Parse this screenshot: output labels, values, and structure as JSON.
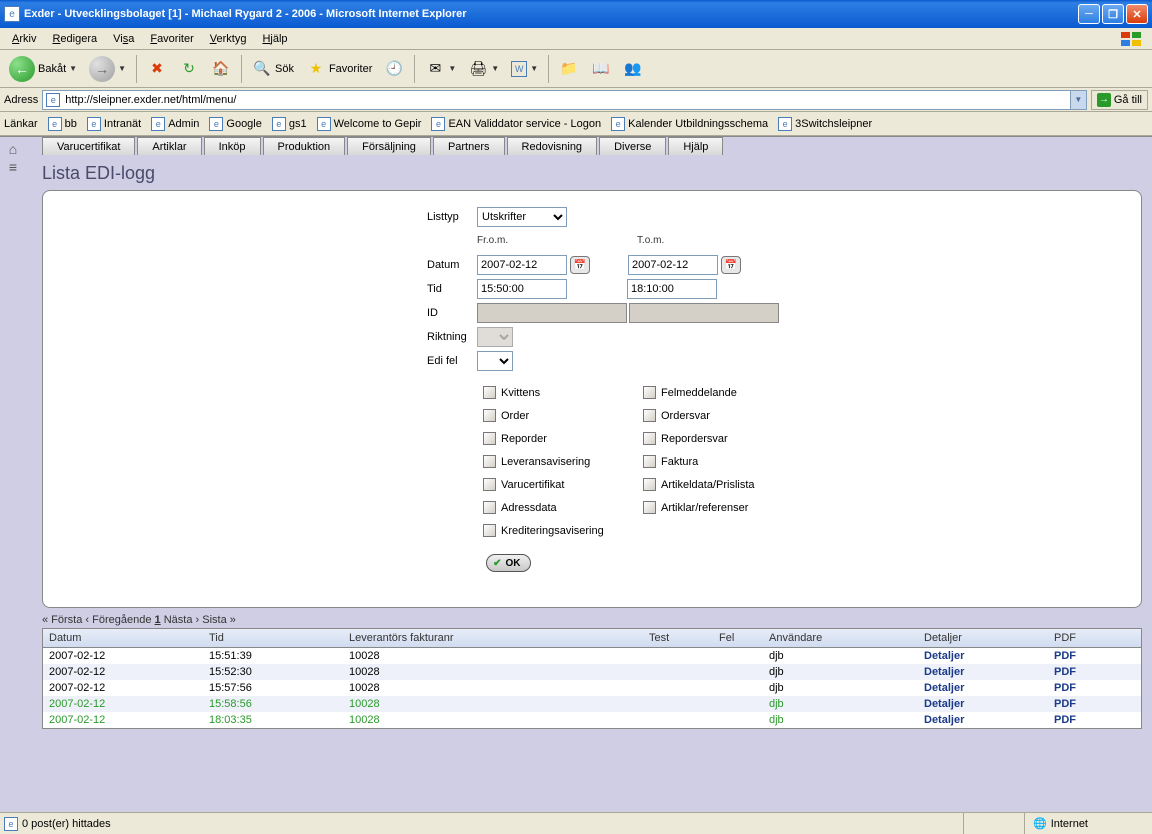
{
  "window": {
    "title": "Exder - Utvecklingsbolaget [1] - Michael Rygard 2 - 2006 - Microsoft Internet Explorer"
  },
  "menu": {
    "items": [
      "Arkiv",
      "Redigera",
      "Visa",
      "Favoriter",
      "Verktyg",
      "Hjälp"
    ]
  },
  "toolbar": {
    "back": "Bakåt",
    "search": "Sök",
    "favorites": "Favoriter"
  },
  "address": {
    "label": "Adress",
    "url": "http://sleipner.exder.net/html/menu/",
    "go": "Gå till"
  },
  "links": {
    "label": "Länkar",
    "items": [
      "bb",
      "Intranät",
      "Admin",
      "Google",
      "gs1",
      "Welcome to Gepir",
      "EAN Validdator service - Logon",
      "Kalender Utbildningsschema",
      "3Switchsleipner"
    ]
  },
  "app": {
    "tabs": [
      "Varucertifikat",
      "Artiklar",
      "Inköp",
      "Produktion",
      "Försäljning",
      "Partners",
      "Redovisning",
      "Diverse",
      "Hjälp"
    ],
    "title": "Lista EDI-logg"
  },
  "form": {
    "listtyp_label": "Listtyp",
    "listtyp_value": "Utskrifter",
    "from_label": "Fr.o.m.",
    "to_label": "T.o.m.",
    "datum_label": "Datum",
    "datum_from": "2007-02-12",
    "datum_to": "2007-02-12",
    "tid_label": "Tid",
    "tid_from": "15:50:00",
    "tid_to": "18:10:00",
    "id_label": "ID",
    "riktning_label": "Riktning",
    "edifel_label": "Edi fel",
    "ok": "OK"
  },
  "checks": {
    "left": [
      "Kvittens",
      "Order",
      "Reporder",
      "Leveransavisering",
      "Varucertifikat",
      "Adressdata",
      "Krediteringsavisering"
    ],
    "right": [
      "Felmeddelande",
      "Ordersvar",
      "Repordersvar",
      "Faktura",
      "Artikeldata/Prislista",
      "Artiklar/referenser"
    ]
  },
  "pager": {
    "first": "« Första",
    "prev": "‹ Föregående",
    "cur": "1",
    "next": "Nästa ›",
    "last": "Sista »"
  },
  "table": {
    "headers": [
      "Datum",
      "Tid",
      "Leverantörs fakturanr",
      "Test",
      "Fel",
      "Användare",
      "Detaljer",
      "PDF"
    ],
    "rows": [
      {
        "datum": "2007-02-12",
        "tid": "15:51:39",
        "lev": "10028",
        "test": "",
        "fel": "",
        "anv": "djb",
        "green": false
      },
      {
        "datum": "2007-02-12",
        "tid": "15:52:30",
        "lev": "10028",
        "test": "",
        "fel": "",
        "anv": "djb",
        "green": false
      },
      {
        "datum": "2007-02-12",
        "tid": "15:57:56",
        "lev": "10028",
        "test": "",
        "fel": "",
        "anv": "djb",
        "green": false
      },
      {
        "datum": "2007-02-12",
        "tid": "15:58:56",
        "lev": "10028",
        "test": "",
        "fel": "",
        "anv": "djb",
        "green": true
      },
      {
        "datum": "2007-02-12",
        "tid": "18:03:35",
        "lev": "10028",
        "test": "",
        "fel": "",
        "anv": "djb",
        "green": true
      }
    ],
    "detaljer_link": "Detaljer",
    "pdf_link": "PDF"
  },
  "status": {
    "left": "0 post(er) hittades",
    "right": "Internet"
  }
}
